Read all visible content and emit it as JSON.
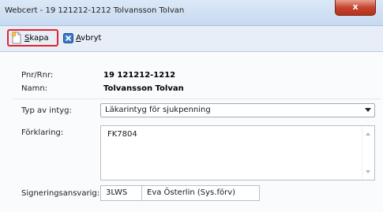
{
  "window": {
    "title": "Webcert - 19 121212-1212 Tolvansson Tolvan",
    "close_glyph": "x"
  },
  "toolbar": {
    "create": {
      "hotkey": "S",
      "rest": "kapa",
      "icon": "new-document-icon"
    },
    "cancel": {
      "hotkey": "A",
      "rest": "vbryt",
      "icon": "blue-x-icon"
    }
  },
  "form": {
    "pnr_label": "Pnr/Rnr:",
    "pnr_value": "19 121212-1212",
    "name_label": "Namn:",
    "name_value": "Tolvansson Tolvan",
    "type_label": "Typ av intyg:",
    "type_value": "Läkarintyg för sjukpenning",
    "explanation_label": "Förklaring:",
    "explanation_value": "FK7804",
    "signer_label": "Signeringsansvarig:",
    "signer_code": "3LWS",
    "signer_name": "Eva Österlin (Sys.förv)"
  },
  "colors": {
    "highlight": "#e0262b",
    "close_button": "#c64430",
    "titlebar": "#dbe8f6"
  }
}
